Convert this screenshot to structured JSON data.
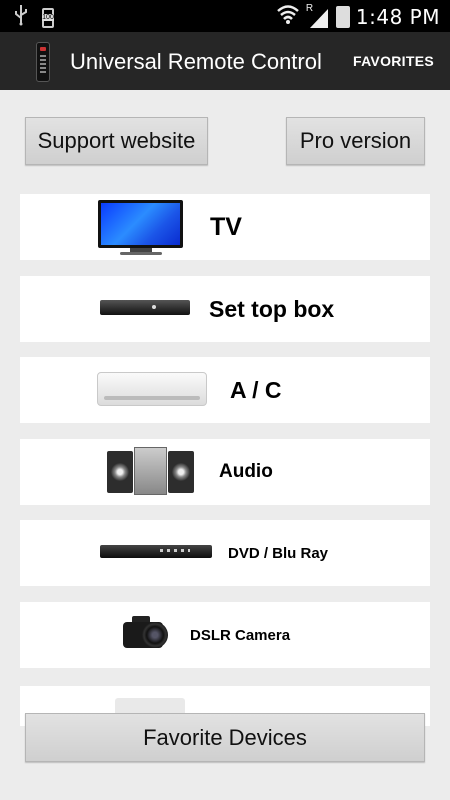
{
  "status_bar": {
    "battery_small_text": "100",
    "signal_label": "R",
    "time": "1:48 PM"
  },
  "action_bar": {
    "title": "Universal Remote Control",
    "favorites_label": "FAVORITES"
  },
  "buttons": {
    "support_label": "Support website",
    "pro_label": "Pro version",
    "favorite_devices_label": "Favorite Devices"
  },
  "devices": [
    {
      "label": "TV",
      "icon": "tv-icon"
    },
    {
      "label": "Set top box",
      "icon": "set-top-box-icon"
    },
    {
      "label": "A / C",
      "icon": "air-conditioner-icon"
    },
    {
      "label": "Audio",
      "icon": "stereo-system-icon"
    },
    {
      "label": "DVD / Blu Ray",
      "icon": "dvd-player-icon"
    },
    {
      "label": "DSLR Camera",
      "icon": "dslr-camera-icon"
    }
  ],
  "colors": {
    "status_bar": "#000000",
    "action_bar": "#262626",
    "background": "#ececec",
    "button_gray": "#d6d6d6"
  }
}
